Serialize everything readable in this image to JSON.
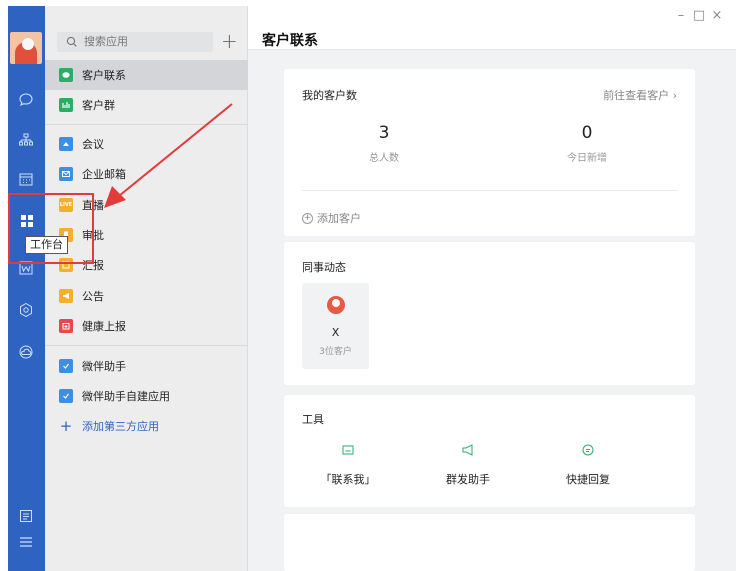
{
  "window": {
    "controls": {
      "minimize": "–",
      "maximize": "□",
      "close": "×"
    }
  },
  "rail": {
    "items": [
      {
        "name": "chat-icon"
      },
      {
        "name": "contacts-icon"
      },
      {
        "name": "calendar-icon"
      },
      {
        "name": "workbench-icon"
      },
      {
        "name": "docs-icon"
      },
      {
        "name": "hexagon-icon"
      },
      {
        "name": "cloud-icon"
      },
      {
        "name": "notes-icon"
      },
      {
        "name": "menu-icon"
      }
    ],
    "tooltip": "工作台"
  },
  "panel": {
    "search_placeholder": "搜索应用",
    "add": "+",
    "apps": [
      {
        "label": "客户联系",
        "color": "#2aae67",
        "selected": true
      },
      {
        "label": "客户群",
        "color": "#2aae67"
      },
      {
        "label": "会议",
        "color": "#3d8fe6"
      },
      {
        "label": "企业邮箱",
        "color": "#3d8fe6"
      },
      {
        "label": "直播",
        "color": "#f4b02d"
      },
      {
        "label": "审批",
        "color": "#f4b02d"
      },
      {
        "label": "汇报",
        "color": "#f4b02d"
      },
      {
        "label": "公告",
        "color": "#f4b02d"
      },
      {
        "label": "健康上报",
        "color": "#e8484b"
      },
      {
        "label": "微伴助手",
        "color": "#3d8fe6"
      },
      {
        "label": "微伴助手自建应用",
        "color": "#3d8fe6"
      }
    ],
    "add_third_party": "添加第三方应用"
  },
  "main": {
    "title": "客户联系",
    "customers": {
      "title": "我的客户数",
      "goto": "前往查看客户 ›",
      "total_value": "3",
      "total_label": "总人数",
      "new_value": "0",
      "new_label": "今日新增",
      "add_label": "添加客户"
    },
    "colleagues": {
      "title": "同事动态",
      "name": "X",
      "sub": "3位客户"
    },
    "tools": {
      "title": "工具",
      "items": [
        {
          "label": "「联系我」"
        },
        {
          "label": "群发助手"
        },
        {
          "label": "快捷回复"
        }
      ]
    }
  },
  "colors": {
    "rail": "#2e63c1",
    "accent_green": "#2aae67",
    "annotation_red": "#e23b3b"
  }
}
